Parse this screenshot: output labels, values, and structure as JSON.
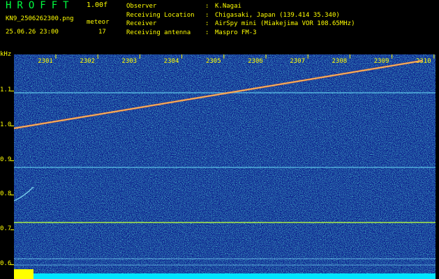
{
  "app": {
    "logo": "HROFFT",
    "version": "1.00f"
  },
  "file": {
    "name": "KN9_2506262300.png",
    "timestamp": "25.06.26 23:00"
  },
  "meteor": {
    "label": "meteor",
    "count": "17"
  },
  "station": {
    "rows": [
      {
        "key": "Observer",
        "value": "K.Nagai"
      },
      {
        "key": "Receiving Location",
        "value": "Chigasaki, Japan (139.414 35.340)"
      },
      {
        "key": "Receiver",
        "value": "AirSpy mini (Miakejima VOR 108.65MHz)"
      },
      {
        "key": "Receiving antenna",
        "value": "Maspro FM-3"
      }
    ]
  },
  "axis": {
    "y_unit": "kHz",
    "y_ticks": [
      "1.1",
      "1.0",
      "0.9",
      "0.8",
      "0.7",
      "0.6"
    ],
    "y_values": [
      1.1,
      1.0,
      0.9,
      0.8,
      0.7,
      0.6
    ],
    "x_ticks": [
      "2301",
      "2302",
      "2303",
      "2304",
      "2305",
      "2306",
      "2307",
      "2308",
      "2309",
      "2310"
    ]
  },
  "colors": {
    "background": "#000000",
    "label": "#ffff00",
    "logo": "#00ff40",
    "spectrum_bg": "#0a1a8a",
    "bottom_bar": "#00e5ff",
    "marker": "#ffff00"
  }
}
